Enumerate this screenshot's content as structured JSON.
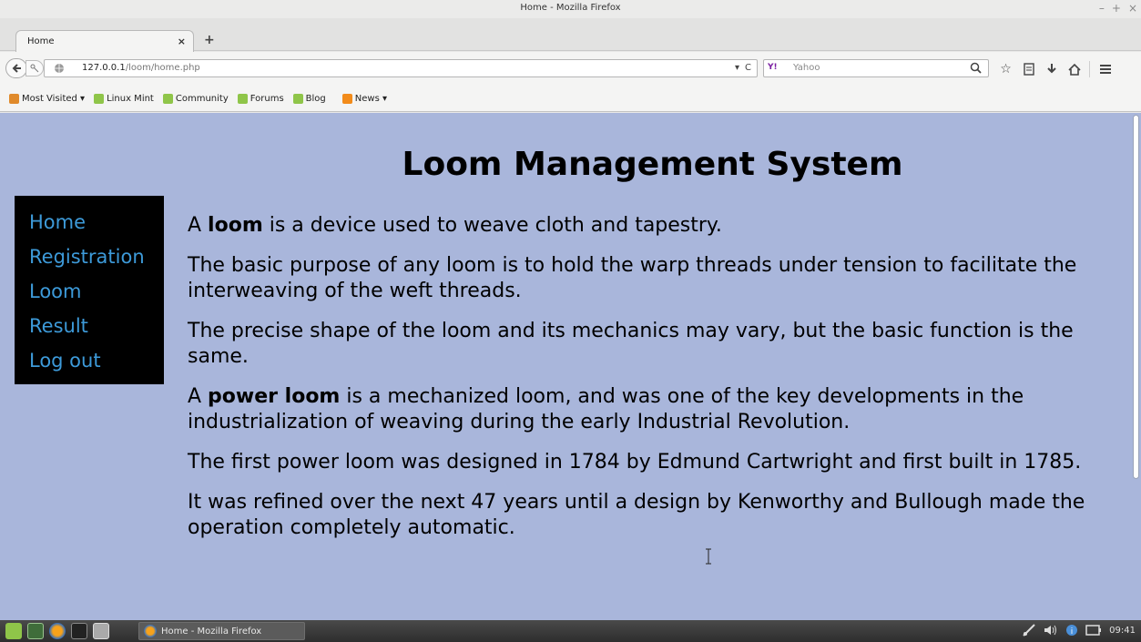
{
  "window": {
    "title": "Home - Mozilla Firefox",
    "controls": [
      "–",
      "+",
      "×"
    ]
  },
  "tabs": {
    "active_label": "Home",
    "close_glyph": "×",
    "new_tab_glyph": "+"
  },
  "navbar": {
    "url_host": "127.0.0.1",
    "url_path": "/loom/home.php",
    "dropdown_glyph": "▾",
    "reload_glyph": "C",
    "search_engine": "Y!",
    "search_placeholder": "Yahoo"
  },
  "bookmarks": [
    {
      "label": "Most Visited ▾",
      "icon": "folder"
    },
    {
      "label": "Linux Mint",
      "icon": "mint"
    },
    {
      "label": "Community",
      "icon": "mint"
    },
    {
      "label": "Forums",
      "icon": "mint"
    },
    {
      "label": "Blog",
      "icon": "mint"
    },
    {
      "label": "News ▾",
      "icon": "rss"
    }
  ],
  "page": {
    "heading": "Loom Management System",
    "nav": [
      "Home",
      "Registration",
      "Loom",
      "Result",
      "Log out"
    ],
    "paragraphs": {
      "p1_pre": "A ",
      "p1_bold": "loom",
      "p1_post": " is a device used to weave cloth and tapestry.",
      "p2": "The basic purpose of any loom is to hold the warp threads under tension to facilitate the interweaving of the weft threads.",
      "p3": "The precise shape of the loom and its mechanics may vary, but the basic function is the same.",
      "p4_pre": "A ",
      "p4_bold": "power loom",
      "p4_post": " is a mechanized loom, and was one of the key developments in the industrialization of weaving during the early Industrial Revolution.",
      "p5": "The first power loom was designed in 1784 by Edmund Cartwright and first built in 1785.",
      "p6": "It was refined over the next 47 years until a design by Kenworthy and Bullough made the operation completely automatic."
    }
  },
  "taskbar": {
    "window_label": "Home - Mozilla Firefox",
    "clock": "09:41"
  },
  "colors": {
    "page_bg": "#a9b6db",
    "nav_bg": "#000000",
    "nav_link": "#3d9ad9"
  }
}
